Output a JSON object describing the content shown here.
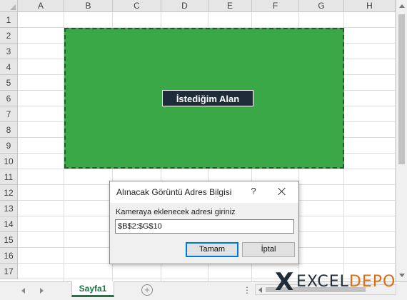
{
  "spreadsheet": {
    "columns": [
      "A",
      "B",
      "C",
      "D",
      "E",
      "F",
      "G",
      "H"
    ],
    "rows": [
      "1",
      "2",
      "3",
      "4",
      "5",
      "6",
      "7",
      "8",
      "9",
      "10",
      "11",
      "12",
      "13",
      "14",
      "15",
      "16",
      "17"
    ],
    "selected_range_label": "İstediğim Alan",
    "range_fill_color": "#3aa847",
    "label_background_color": "#1f2d3b"
  },
  "dialog": {
    "title": "Alınacak Görüntü Adres Bilgisi",
    "help_label": "?",
    "prompt": "Kameraya eklenecek adresi giriniz",
    "input_value": "$B$2:$G$10",
    "ok_label": "Tamam",
    "cancel_label": "İptal",
    "close_icon": "close-icon"
  },
  "statusbar": {
    "sheet_tab": "Sayfa1",
    "add_sheet_symbol": "+",
    "more_symbol": "⋮"
  },
  "watermark": {
    "icon": "X",
    "text_dark": "EXCEL",
    "text_accent": "DEPO",
    "accent_color": "#e36c0a"
  }
}
